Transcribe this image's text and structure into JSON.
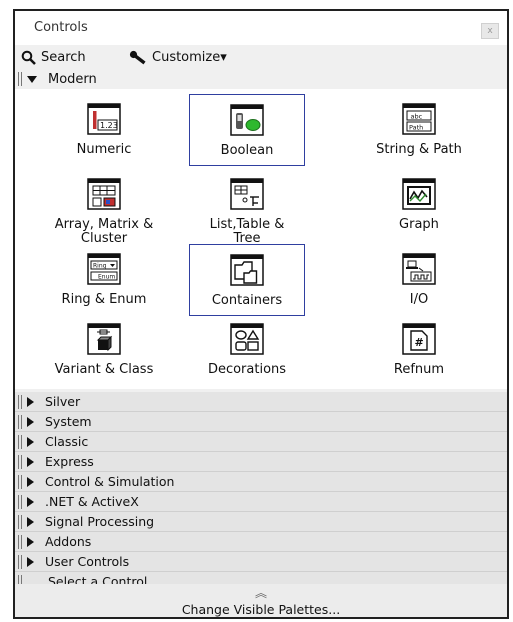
{
  "window": {
    "title": "Controls",
    "close": "x"
  },
  "toolbar": {
    "search": "Search",
    "customize": "Customize▾"
  },
  "section": {
    "label": "Modern"
  },
  "controls": [
    {
      "label": "Numeric"
    },
    {
      "label": "Boolean"
    },
    {
      "label": "String & Path"
    },
    {
      "label": "Array, Matrix &\nCluster"
    },
    {
      "label": "List,Table &\nTree"
    },
    {
      "label": "Graph"
    },
    {
      "label": "Ring & Enum"
    },
    {
      "label": "Containers"
    },
    {
      "label": "I/O"
    },
    {
      "label": "Variant & Class"
    },
    {
      "label": "Decorations"
    },
    {
      "label": "Refnum"
    }
  ],
  "icon_text": {
    "numeric": "1.23",
    "string_top": "abc",
    "string_bottom": "Path",
    "ring": "Ring",
    "enum": "Enum",
    "refnum": "#"
  },
  "categories": [
    {
      "label": "Silver"
    },
    {
      "label": "System"
    },
    {
      "label": "Classic"
    },
    {
      "label": "Express"
    },
    {
      "label": "Control & Simulation"
    },
    {
      "label": ".NET & ActiveX"
    },
    {
      "label": "Signal Processing"
    },
    {
      "label": "Addons"
    },
    {
      "label": "User Controls"
    }
  ],
  "select_control": "Select a Control...",
  "chevron": "︽",
  "change_palettes": "Change Visible Palettes..."
}
